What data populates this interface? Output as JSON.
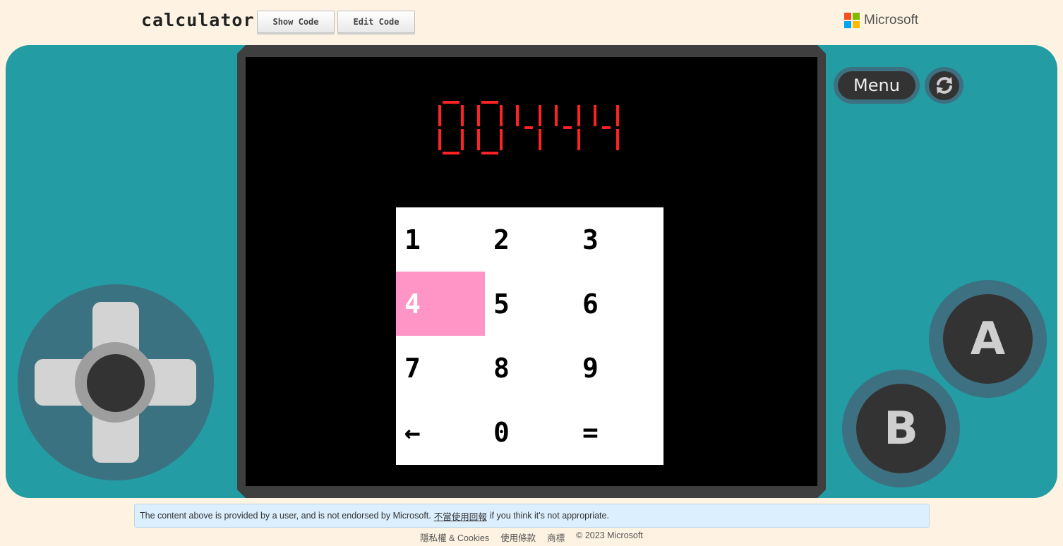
{
  "header": {
    "title": "calculator",
    "show_code_label": "Show Code",
    "edit_code_label": "Edit Code",
    "brand_name": "Microsoft",
    "brand_colors": [
      "#f25022",
      "#7fba00",
      "#00a4ef",
      "#ffb900"
    ]
  },
  "console": {
    "menu_label": "Menu",
    "a_label": "A",
    "b_label": "B",
    "body_color": "#239ca4",
    "dpad_icon": "dpad-icon",
    "refresh_icon": "refresh-icon"
  },
  "screen": {
    "display_value": "00444",
    "display_color": "#ff2222",
    "keypad": {
      "keys": [
        [
          "1",
          "2",
          "3"
        ],
        [
          "4",
          "5",
          "6"
        ],
        [
          "7",
          "8",
          "9"
        ],
        [
          "←",
          "0",
          "="
        ]
      ],
      "selected_row": 1,
      "selected_col": 0,
      "selected_color": "#ff94c6"
    }
  },
  "notice": {
    "text_before": "The content above is provided by a user, and is not endorsed by Microsoft.",
    "link_text": "不當使用回報",
    "text_after": "if you think it's not appropriate."
  },
  "footer": {
    "privacy": "隱私權 & Cookies",
    "terms": "使用條款",
    "trademarks": "商標",
    "copyright": "© 2023 Microsoft"
  }
}
